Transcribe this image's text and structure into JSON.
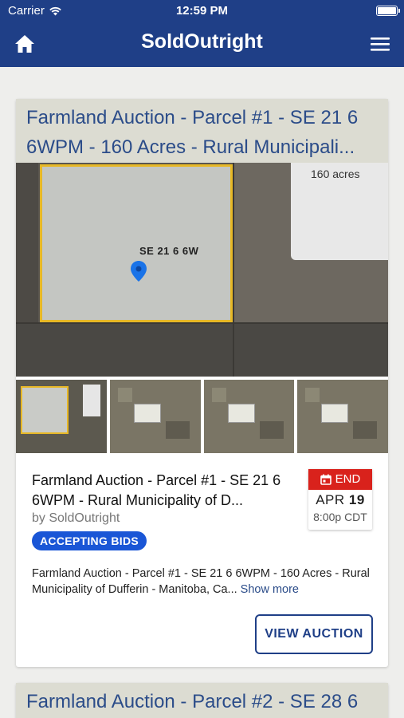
{
  "status_bar": {
    "carrier": "Carrier",
    "time": "12:59 PM"
  },
  "nav": {
    "title": "SoldOutright"
  },
  "listings": [
    {
      "header_title": "Farmland Auction - Parcel #1 - SE 21 6 6WPM - 160 Acres - Rural Municipali...",
      "image": {
        "acres_label": "160 acres",
        "parcel_label": "SE 21 6 6W"
      },
      "title": "Farmland Auction - Parcel #1 - SE 21 6 6WPM - Rural Municipality of D...",
      "byline": "by SoldOutright",
      "badge": "ACCEPTING BIDS",
      "end_label": "END",
      "end_month": "APR",
      "end_day": "19",
      "end_time": "8:00p CDT",
      "description": "Farmland Auction - Parcel #1 - SE 21 6 6WPM - 160 Acres - Rural Municipality of Dufferin - Manitoba, Ca...",
      "show_more": "Show more",
      "button": "VIEW AUCTION"
    },
    {
      "header_title": "Farmland Auction - Parcel #2 - SE 28 6"
    }
  ],
  "colors": {
    "nav": "#1f3f87",
    "badge": "#1a56d6",
    "end": "#d9221c",
    "title": "#2b4c89"
  },
  "icons": [
    "wifi-icon",
    "battery-icon",
    "home-icon",
    "menu-icon",
    "location-pin-icon",
    "calendar-icon"
  ]
}
